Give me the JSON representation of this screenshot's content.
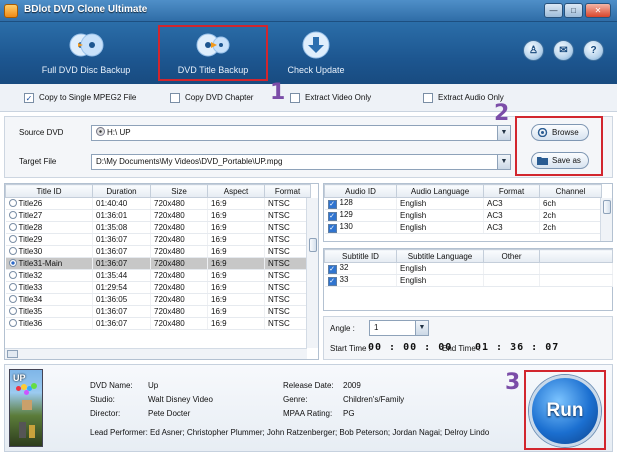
{
  "window": {
    "title": "BDlot DVD Clone Ultimate"
  },
  "toolbar": {
    "items": [
      {
        "label": "Full DVD Disc Backup"
      },
      {
        "label": "DVD Title Backup"
      },
      {
        "label": "Check Update"
      }
    ]
  },
  "options": [
    {
      "label": "Copy to Single MPEG2 File",
      "checked": true
    },
    {
      "label": "Copy DVD Chapter",
      "checked": false
    },
    {
      "label": "Extract Video Only",
      "checked": false
    },
    {
      "label": "Extract Audio Only",
      "checked": false
    }
  ],
  "paths": {
    "source_label": "Source DVD",
    "source_value": "H:\\ UP",
    "target_label": "Target File",
    "target_value": "D:\\My Documents\\My Videos\\DVD_Portable\\UP.mpg",
    "browse_label": "Browse",
    "saveas_label": "Save as"
  },
  "titles": {
    "headers": [
      "Title ID",
      "Duration",
      "Size",
      "Aspect",
      "Format"
    ],
    "rows": [
      [
        "Title26",
        "01:40:40",
        "720x480",
        "16:9",
        "NTSC"
      ],
      [
        "Title27",
        "01:36:01",
        "720x480",
        "16:9",
        "NTSC"
      ],
      [
        "Title28",
        "01:35:08",
        "720x480",
        "16:9",
        "NTSC"
      ],
      [
        "Title29",
        "01:36:07",
        "720x480",
        "16:9",
        "NTSC"
      ],
      [
        "Title30",
        "01:36:07",
        "720x480",
        "16:9",
        "NTSC"
      ],
      [
        "Title31-Main",
        "01:36:07",
        "720x480",
        "16:9",
        "NTSC"
      ],
      [
        "Title32",
        "01:35:44",
        "720x480",
        "16:9",
        "NTSC"
      ],
      [
        "Title33",
        "01:29:54",
        "720x480",
        "16:9",
        "NTSC"
      ],
      [
        "Title34",
        "01:36:05",
        "720x480",
        "16:9",
        "NTSC"
      ],
      [
        "Title35",
        "01:36:07",
        "720x480",
        "16:9",
        "NTSC"
      ],
      [
        "Title36",
        "01:36:07",
        "720x480",
        "16:9",
        "NTSC"
      ]
    ],
    "selected_index": 5
  },
  "audio": {
    "headers": [
      "Audio ID",
      "Audio Language",
      "Format",
      "Channel"
    ],
    "rows": [
      [
        "128",
        "English",
        "AC3",
        "6ch"
      ],
      [
        "129",
        "English",
        "AC3",
        "2ch"
      ],
      [
        "130",
        "English",
        "AC3",
        "2ch"
      ]
    ]
  },
  "subtitles": {
    "headers": [
      "Subtitle ID",
      "Subtitle Language",
      "Other"
    ],
    "rows": [
      [
        "32",
        "English",
        ""
      ],
      [
        "33",
        "English",
        ""
      ]
    ]
  },
  "angle": {
    "label": "Angle :",
    "value": "1",
    "start_label": "Start Time :",
    "start_value": "00 : 00 : 00",
    "end_label": "End Time :",
    "end_value": "01 : 36 : 07"
  },
  "info": {
    "dvd_name_label": "DVD Name:",
    "dvd_name": "Up",
    "studio_label": "Studio:",
    "studio": "Walt Disney Video",
    "director_label": "Director:",
    "director": "Pete Docter",
    "release_label": "Release Date:",
    "release": "2009",
    "genre_label": "Genre:",
    "genre": "Children's/Family",
    "rating_label": "MPAA Rating:",
    "rating": "PG",
    "performer_label": "Lead Performer:",
    "performer": "Ed Asner; Christopher Plummer; John Ratzenberger; Bob Peterson; Jordan Nagai; Delroy Lindo",
    "poster_text": "UP"
  },
  "run_label": "Run",
  "annotations": [
    "1",
    "2",
    "3"
  ],
  "colors": {
    "toolbar": "#1d5690",
    "highlight": "#d2262e",
    "step": "#7b4da8"
  }
}
